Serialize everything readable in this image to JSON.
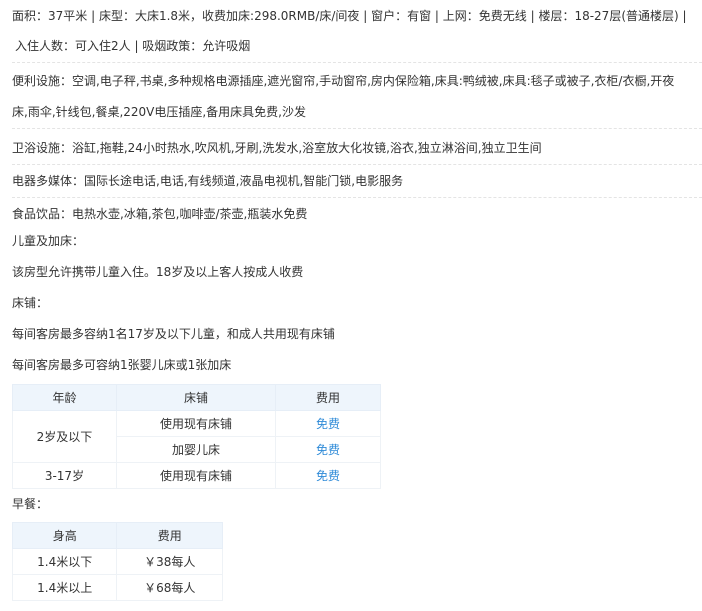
{
  "room": {
    "line1": "面积：37平米 | 床型：大床1.8米，收费加床:298.0RMB/床/间夜 | 窗户：有窗 | 上网：免费无线 | 楼层：18-27层(普通楼层) |",
    "line2": "入住人数：可入住2人 | 吸烟政策：允许吸烟"
  },
  "facilities": [
    {
      "label": "便利设施：",
      "lines": [
        "空调,电子秤,书桌,多种规格电源插座,遮光窗帘,手动窗帘,房内保险箱,床具:鸭绒被,床具:毯子或被子,衣柜/衣橱,开夜",
        "床,雨伞,针线包,餐桌,220V电压插座,备用床具免费,沙发"
      ]
    },
    {
      "label": "卫浴设施：",
      "lines": [
        "浴缸,拖鞋,24小时热水,吹风机,牙刷,洗发水,浴室放大化妆镜,浴衣,独立淋浴间,独立卫生间"
      ]
    },
    {
      "label": "电器多媒体：",
      "lines": [
        "国际长途电话,电话,有线频道,液晶电视机,智能门锁,电影服务"
      ]
    },
    {
      "label": "食品饮品：",
      "lines": [
        "电热水壶,冰箱,茶包,咖啡壶/茶壶,瓶装水免费"
      ]
    }
  ],
  "children": {
    "title": "儿童及加床：",
    "policy": "该房型允许携带儿童入住。18岁及以上客人按成人收费",
    "bed_title": "床铺：",
    "bed_line1": "每间客房最多容纳1名17岁及以下儿童，和成人共用现有床铺",
    "bed_line2": "每间客房最多可容纳1张婴儿床或1张加床",
    "table": {
      "headers": [
        "年龄",
        "床铺",
        "费用"
      ],
      "rows": [
        {
          "age": "2岁及以下",
          "bed": "使用现有床铺",
          "fee": "免费"
        },
        {
          "age": "",
          "bed": "加婴儿床",
          "fee": "免费"
        },
        {
          "age": "3-17岁",
          "bed": "使用现有床铺",
          "fee": "免费"
        }
      ]
    }
  },
  "breakfast": {
    "title": "早餐：",
    "table": {
      "headers": [
        "身高",
        "费用"
      ],
      "rows": [
        {
          "height": "1.4米以下",
          "fee": "￥38每人"
        },
        {
          "height": "1.4米以上",
          "fee": "￥68每人"
        }
      ]
    }
  }
}
